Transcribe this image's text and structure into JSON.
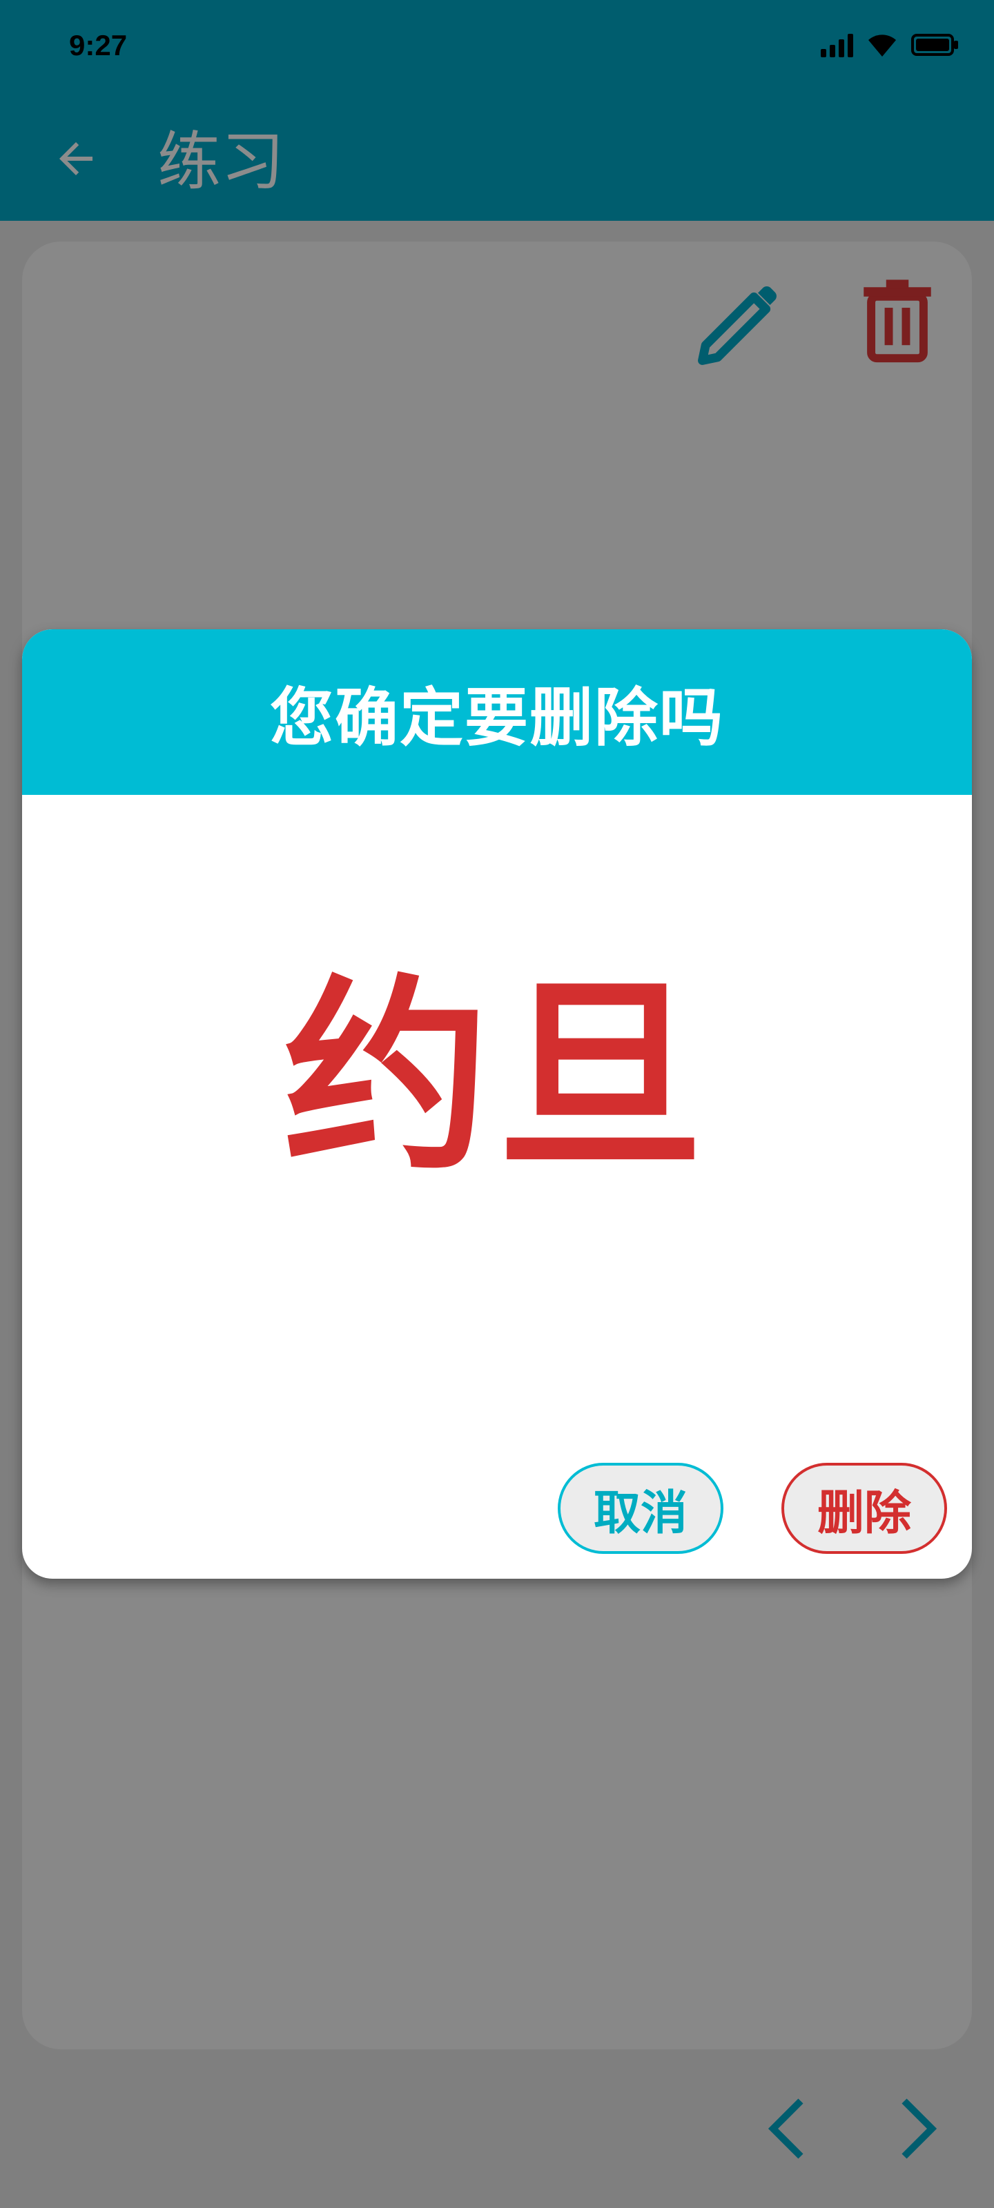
{
  "status_bar": {
    "time": "9:27",
    "icons": [
      "signal-icon",
      "wifi-icon",
      "battery-icon"
    ]
  },
  "app_bar": {
    "title": "练习",
    "back_icon": "arrow-back-icon"
  },
  "card": {
    "edit_icon": "pencil-icon",
    "delete_icon": "trash-icon"
  },
  "navigation": {
    "prev_icon": "chevron-left-icon",
    "next_icon": "chevron-right-icon"
  },
  "dialog": {
    "title": "您确定要删除吗",
    "word": "约旦",
    "cancel_label": "取消",
    "delete_label": "删除"
  },
  "colors": {
    "app_bar": "#005d6e",
    "dialog_header": "#00bcd4",
    "danger": "#d32f2f",
    "scrim": "#7f7f7f"
  }
}
